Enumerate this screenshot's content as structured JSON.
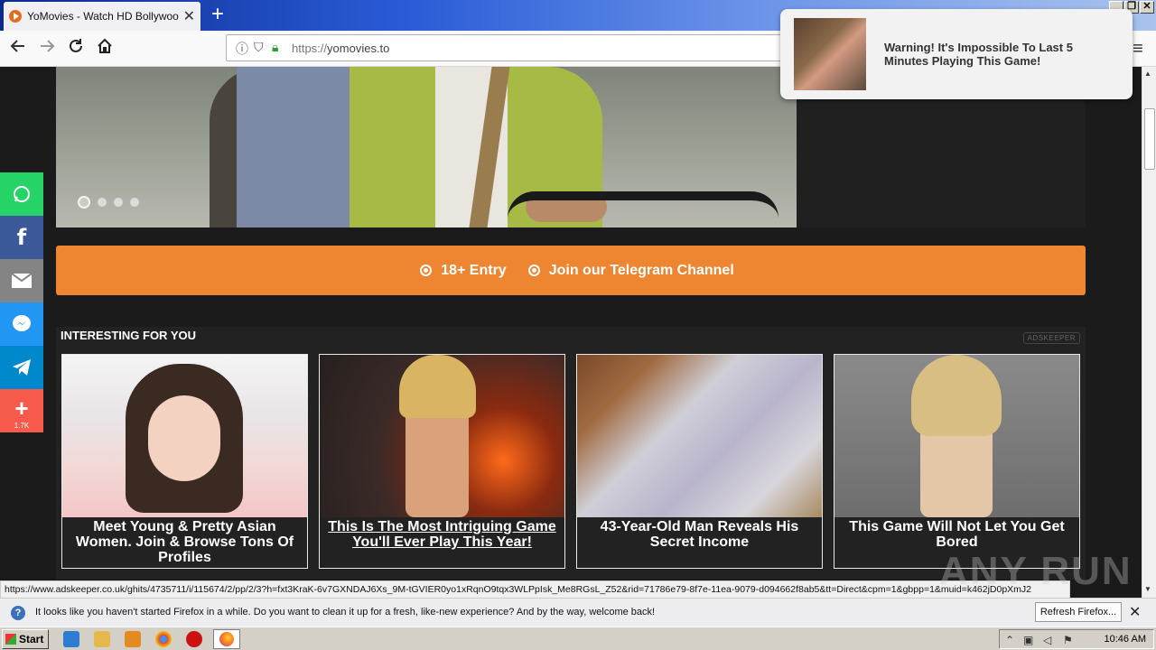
{
  "browser": {
    "tab_title": "YoMovies - Watch HD Bollywood H",
    "tab_close": "✕",
    "new_tab": "+",
    "url_prefix": "https://",
    "url_host": "yomovies.to",
    "page_actions": "•••"
  },
  "window_controls": {
    "minimize": "_",
    "restore": "❐",
    "close": "✕"
  },
  "nav_icons": [
    "back-icon",
    "forward-icon",
    "reload-icon",
    "home-icon",
    "library-icon",
    "sidebar-icon",
    "account-icon",
    "menu-icon"
  ],
  "notification": {
    "text": "Warning! It's Impossible To Last 5 Minutes Playing This Game!"
  },
  "slider": {
    "dots": 4,
    "active_dot": 1
  },
  "telegram_bar": {
    "items": [
      "18+ Entry",
      "Join our Telegram Channel"
    ],
    "color": "#ed8531"
  },
  "ads": {
    "heading": "INTERESTING FOR YOU",
    "brand": "ADSKEEPER",
    "cards": [
      {
        "caption": "Meet Young & Pretty Asian Women. Join & Browse Tons Of Profiles"
      },
      {
        "caption": "This Is The Most Intriguing Game You'll Ever Play This Year!"
      },
      {
        "caption": "43-Year-Old Man Reveals His Secret Income"
      },
      {
        "caption": "This Game Will Not Let You Get Bored"
      }
    ]
  },
  "share": {
    "buttons": [
      {
        "name": "whatsapp",
        "color": "#25d366"
      },
      {
        "name": "facebook",
        "color": "#3b5998"
      },
      {
        "name": "email",
        "color": "#848484"
      },
      {
        "name": "messenger",
        "color": "#2196f3"
      },
      {
        "name": "telegram",
        "color": "#0088cc"
      },
      {
        "name": "more",
        "color": "#f65a4a"
      }
    ],
    "count": "1.7K"
  },
  "status_url": "https://www.adskeeper.co.uk/ghits/4735711/i/115674/2/pp/2/3?h=fxt3KraK-6v7GXNDAJ6Xs_9M-tGVIER0yo1xRqnO9tqx3WLPpIsk_Me8RGsL_Z52&rid=71786e79-8f7e-11ea-9079-d094662f8ab5&tt=Direct&cpm=1&gbpp=1&muid=k462jD0pXmJ2",
  "infobar": {
    "message": "It looks like you haven't started Firefox in a while. Do you want to clean it up for a fresh, like-new experience? And by the way, welcome back!",
    "refresh_label": "Refresh Firefox...",
    "close": "✕"
  },
  "watermark": "ANY RUN",
  "taskbar": {
    "start_label": "Start",
    "time": "10:46 AM"
  }
}
